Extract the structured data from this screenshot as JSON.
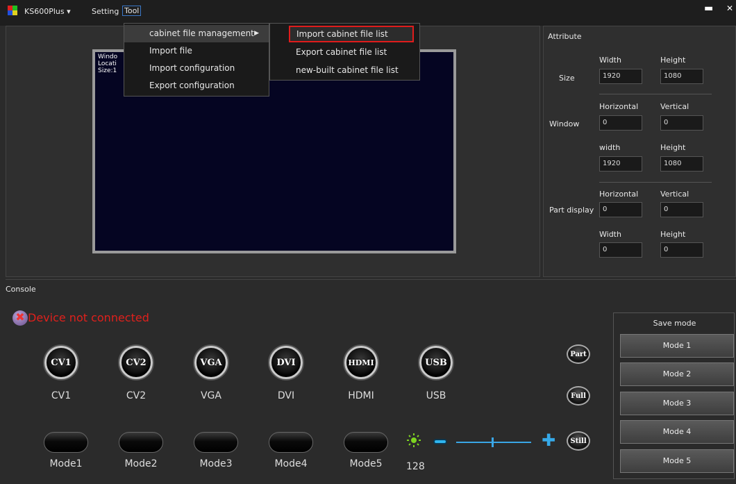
{
  "titlebar": {
    "device": "KS600Plus",
    "device_arrow": "▾",
    "menu_setting": "Setting",
    "menu_tool": "Tool",
    "minimize": "▬",
    "close": "✕"
  },
  "tool_menu": {
    "items": [
      {
        "label": "cabinet file management",
        "has_submenu": true
      },
      {
        "label": "Import file"
      },
      {
        "label": "Import configuration"
      },
      {
        "label": "Export configuration"
      }
    ],
    "submenu_arrow": "▶"
  },
  "cabinet_submenu": {
    "items": [
      {
        "label": "Import cabinet file list"
      },
      {
        "label": "Export cabinet file list"
      },
      {
        "label": "new-built cabinet file list"
      }
    ]
  },
  "preview": {
    "info_line1": "Windo",
    "info_line2": "Locati",
    "info_line3": "Size:1"
  },
  "attribute": {
    "title": "Attribute",
    "size": {
      "label": "Size",
      "width_label": "Width",
      "height_label": "Height",
      "width": "1920",
      "height": "1080"
    },
    "window": {
      "label": "Window",
      "h_label": "Horizontal",
      "v_label": "Vertical",
      "horizontal": "0",
      "vertical": "0",
      "w_label": "width",
      "ht_label": "Height",
      "width": "1920",
      "height": "1080"
    },
    "part_display": {
      "label": "Part display",
      "h_label": "Horizontal",
      "v_label": "Vertical",
      "horizontal": "0",
      "vertical": "0",
      "w_label": "Width",
      "ht_label": "Height",
      "width": "0",
      "height": "0"
    }
  },
  "console": {
    "title": "Console",
    "status": "Device not connected",
    "status_icon": "✖",
    "sources": [
      {
        "icon_text": "CV1",
        "label": "CV1"
      },
      {
        "icon_text": "CV2",
        "label": "CV2"
      },
      {
        "icon_text": "VGA",
        "label": "VGA"
      },
      {
        "icon_text": "DVI",
        "label": "DVI"
      },
      {
        "icon_text": "HDMI",
        "label": "HDMI"
      },
      {
        "icon_text": "USB",
        "label": "USB"
      }
    ],
    "side_buttons": [
      "Part",
      "Full",
      "Still"
    ],
    "modes": [
      "Mode1",
      "Mode2",
      "Mode3",
      "Mode4",
      "Mode5"
    ],
    "brightness": "128",
    "plus": "✚"
  },
  "save_mode": {
    "title": "Save mode",
    "buttons": [
      "Mode 1",
      "Mode 2",
      "Mode 3",
      "Mode 4",
      "Mode 5"
    ]
  },
  "colors": {
    "accent_blue": "#3aa6e6",
    "status_red": "#e0201c",
    "highlight_border": "#e01c1c"
  }
}
